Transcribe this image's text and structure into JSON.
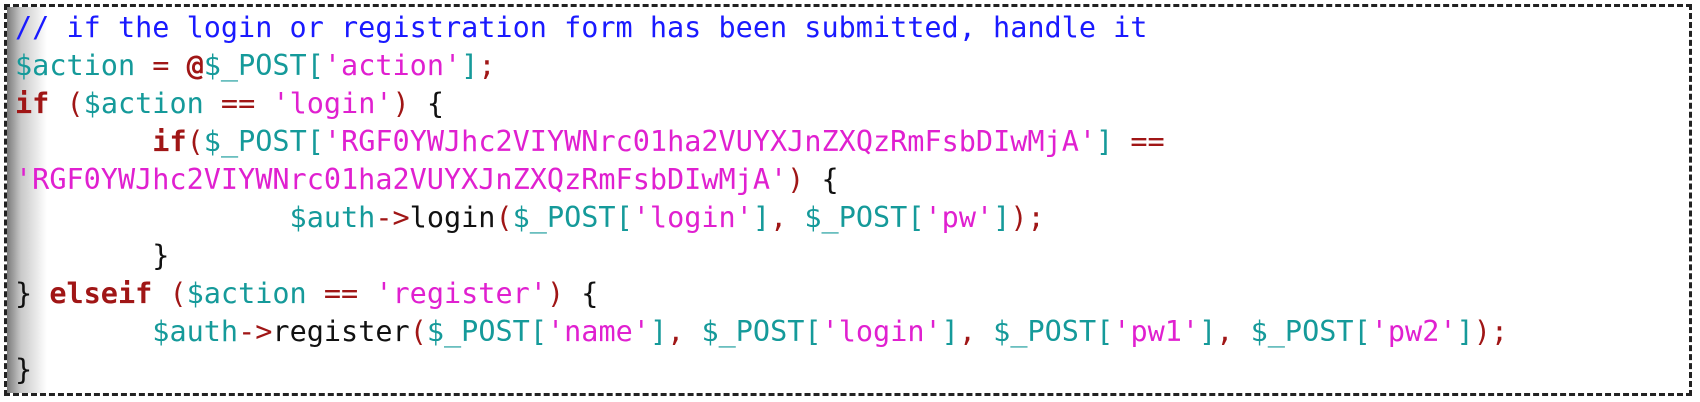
{
  "editor": {
    "lines": [
      [
        {
          "t": "// if the login or registration form has been submitted, handle it",
          "c": "cmt"
        }
      ],
      [
        {
          "t": "$action",
          "c": "var"
        },
        {
          "t": " = ",
          "c": "op"
        },
        {
          "t": "@",
          "c": "kw"
        },
        {
          "t": "$_POST",
          "c": "var"
        },
        {
          "t": "[",
          "c": "var"
        },
        {
          "t": "'action'",
          "c": "str"
        },
        {
          "t": "]",
          "c": "var"
        },
        {
          "t": ";",
          "c": "op"
        }
      ],
      [
        {
          "t": "if",
          "c": "kw"
        },
        {
          "t": " (",
          "c": "op"
        },
        {
          "t": "$action",
          "c": "var"
        },
        {
          "t": " == ",
          "c": "op"
        },
        {
          "t": "'login'",
          "c": "str"
        },
        {
          "t": ") ",
          "c": "op"
        },
        {
          "t": "{",
          "c": "pl"
        }
      ],
      [
        {
          "t": "        ",
          "c": "pl"
        },
        {
          "t": "if",
          "c": "kw"
        },
        {
          "t": "(",
          "c": "op"
        },
        {
          "t": "$_POST",
          "c": "var"
        },
        {
          "t": "[",
          "c": "var"
        },
        {
          "t": "'RGF0YWJhc2VIYWNrc01ha2VUYXJnZXQzRmFsbDIwMjA'",
          "c": "str"
        },
        {
          "t": "]",
          "c": "var"
        },
        {
          "t": " ==",
          "c": "op"
        }
      ],
      [
        {
          "t": "'RGF0YWJhc2VIYWNrc01ha2VUYXJnZXQzRmFsbDIwMjA'",
          "c": "str"
        },
        {
          "t": ") ",
          "c": "op"
        },
        {
          "t": "{",
          "c": "pl"
        }
      ],
      [
        {
          "t": "                ",
          "c": "pl"
        },
        {
          "t": "$auth",
          "c": "var"
        },
        {
          "t": "->",
          "c": "op"
        },
        {
          "t": "login",
          "c": "fn"
        },
        {
          "t": "(",
          "c": "op"
        },
        {
          "t": "$_POST",
          "c": "var"
        },
        {
          "t": "[",
          "c": "var"
        },
        {
          "t": "'login'",
          "c": "str"
        },
        {
          "t": "]",
          "c": "var"
        },
        {
          "t": ", ",
          "c": "op"
        },
        {
          "t": "$_POST",
          "c": "var"
        },
        {
          "t": "[",
          "c": "var"
        },
        {
          "t": "'pw'",
          "c": "str"
        },
        {
          "t": "]",
          "c": "var"
        },
        {
          "t": ");",
          "c": "op"
        }
      ],
      [
        {
          "t": "        ",
          "c": "pl"
        },
        {
          "t": "}",
          "c": "pl"
        }
      ],
      [
        {
          "t": "} ",
          "c": "pl"
        },
        {
          "t": "elseif",
          "c": "kw"
        },
        {
          "t": " (",
          "c": "op"
        },
        {
          "t": "$action",
          "c": "var"
        },
        {
          "t": " == ",
          "c": "op"
        },
        {
          "t": "'register'",
          "c": "str"
        },
        {
          "t": ") ",
          "c": "op"
        },
        {
          "t": "{",
          "c": "pl"
        }
      ],
      [
        {
          "t": "        ",
          "c": "pl"
        },
        {
          "t": "$auth",
          "c": "var"
        },
        {
          "t": "->",
          "c": "op"
        },
        {
          "t": "register",
          "c": "fn"
        },
        {
          "t": "(",
          "c": "op"
        },
        {
          "t": "$_POST",
          "c": "var"
        },
        {
          "t": "[",
          "c": "var"
        },
        {
          "t": "'name'",
          "c": "str"
        },
        {
          "t": "]",
          "c": "var"
        },
        {
          "t": ", ",
          "c": "op"
        },
        {
          "t": "$_POST",
          "c": "var"
        },
        {
          "t": "[",
          "c": "var"
        },
        {
          "t": "'login'",
          "c": "str"
        },
        {
          "t": "]",
          "c": "var"
        },
        {
          "t": ", ",
          "c": "op"
        },
        {
          "t": "$_POST",
          "c": "var"
        },
        {
          "t": "[",
          "c": "var"
        },
        {
          "t": "'pw1'",
          "c": "str"
        },
        {
          "t": "]",
          "c": "var"
        },
        {
          "t": ", ",
          "c": "op"
        },
        {
          "t": "$_POST",
          "c": "var"
        },
        {
          "t": "[",
          "c": "var"
        },
        {
          "t": "'pw2'",
          "c": "str"
        },
        {
          "t": "]",
          "c": "var"
        },
        {
          "t": ");",
          "c": "op"
        }
      ],
      [
        {
          "t": "}",
          "c": "pl"
        }
      ]
    ]
  }
}
